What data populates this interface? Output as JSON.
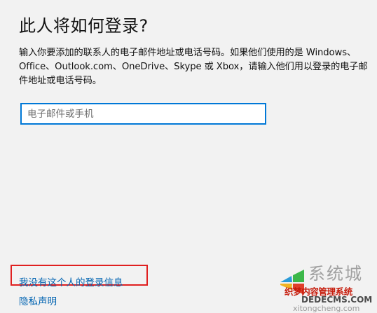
{
  "dialog": {
    "title": "此人将如何登录?",
    "description": "输入你要添加的联系人的电子邮件地址或电话号码。如果他们使用的是 Windows、Office、Outlook.com、OneDrive、Skype 或 Xbox，请输入他们用以登录的电子邮件地址或电话号码。",
    "email_input": {
      "value": "",
      "placeholder": "电子邮件或手机"
    },
    "links": {
      "no_signin_info": "我没有这个人的登录信息",
      "privacy": "隐私声明"
    },
    "accent_color": "#0078d7",
    "highlight_color": "#e02020"
  },
  "watermark": {
    "logo_icon": "windows-logo-icon",
    "big_text": "系统城",
    "line1": "织梦内容管理系统",
    "line2": "DEDECMS.COM",
    "line3": "xitongcheng.com"
  }
}
